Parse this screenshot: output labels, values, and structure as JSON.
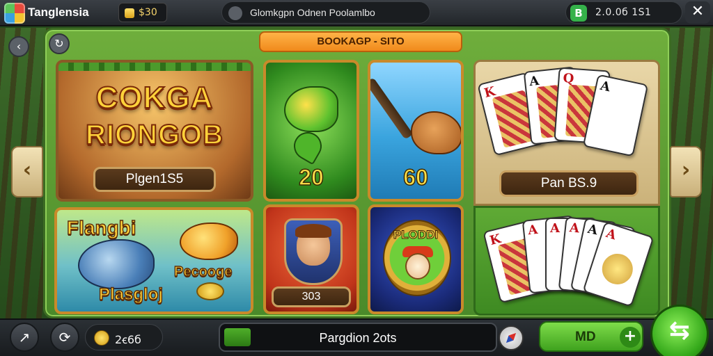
{
  "topbar": {
    "app_title": "Tanglensia",
    "coins": "$30",
    "search_text": "Glomkgpn Odnen Poolamlbo",
    "balance_badge": "B",
    "balance": "2.0.0б  1S1",
    "close": "✕"
  },
  "nav": {
    "back_icon": "‹",
    "refresh_icon": "↻",
    "left_arrow": "‹",
    "right_arrow": "›"
  },
  "banner": "BOOKAGP - SITO",
  "tiles": {
    "big1": {
      "title_line1": "COKGA",
      "title_line2": "RIONGOB",
      "plaque": "Plgen1S5"
    },
    "fish_green": {
      "number": "20"
    },
    "hunter": {
      "number": "60"
    },
    "cards_top": {
      "plaque": "Pan BS.9",
      "cards": [
        "K",
        "A",
        "Q",
        "A"
      ]
    },
    "fish2": {
      "top_text": "Flangbi",
      "mid_text": "Pecooge",
      "bottom_text": "Plasgloj"
    },
    "hero": {
      "plaque": "303"
    },
    "badge": {
      "text": "PLODDI"
    },
    "cards_bottom": {
      "cards": [
        "K",
        "A",
        "A",
        "A",
        "A",
        "A"
      ]
    }
  },
  "bottombar": {
    "share_icon": "↗",
    "sync_icon": "⟳",
    "gold": "2ꞓ6б",
    "progress_label": "Pargdion 2ots",
    "progress_fraction": 0.1,
    "mid_button": "MD",
    "plus": "+",
    "big_button_icon": "⇆"
  },
  "colors": {
    "frame_green": "#6fae3c",
    "banner_orange": "#f08a1c",
    "gold_text": "#ffd23a",
    "action_green": "#3fa21e"
  },
  "icons": [
    "app-logo",
    "coin",
    "search-dot",
    "balance-badge",
    "close-icon",
    "back-icon",
    "refresh-icon",
    "arrow-left",
    "arrow-right",
    "share-icon",
    "sync-icon",
    "compass-icon",
    "plus-icon",
    "swap-icon"
  ]
}
